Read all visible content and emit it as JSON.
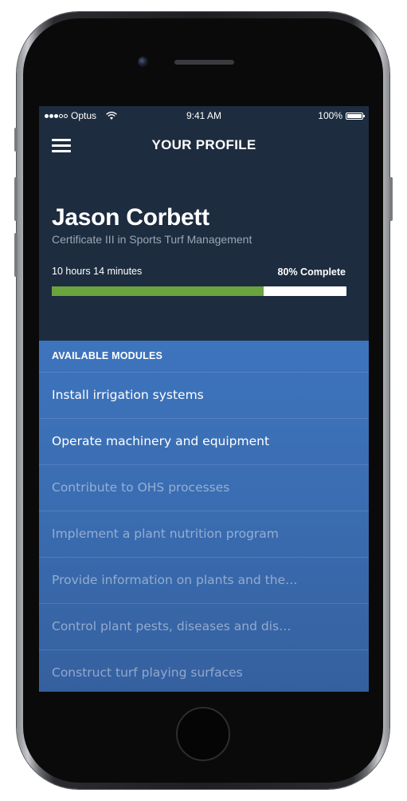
{
  "status_bar": {
    "carrier": "Optus",
    "time": "9:41 AM",
    "battery": "100%",
    "signal_dots": [
      true,
      true,
      true,
      false,
      false
    ]
  },
  "nav": {
    "title": "YOUR PROFILE",
    "menu_icon": "hamburger-icon"
  },
  "profile": {
    "name": "Jason Corbett",
    "course": "Certificate III in Sports Turf Management",
    "time_spent": "10 hours 14 minutes",
    "complete_label": "80% Complete",
    "progress_percent": 72
  },
  "modules": {
    "header": "AVAILABLE MODULES",
    "items": [
      {
        "label": "Install irrigation systems",
        "state": "active"
      },
      {
        "label": "Operate machinery and equipment",
        "state": "active"
      },
      {
        "label": "Contribute to OHS processes",
        "state": "locked"
      },
      {
        "label": "Implement a plant nutrition program",
        "state": "locked"
      },
      {
        "label": "Provide information on plants and the…",
        "state": "locked"
      },
      {
        "label": "Control plant pests, diseases and dis…",
        "state": "locked"
      },
      {
        "label": "Construct turf playing surfaces",
        "state": "locked"
      }
    ]
  },
  "colors": {
    "screen_bg": "#1d2c3f",
    "modules_bg": "#3d74bd",
    "progress_fill": "#6ba33f",
    "progress_track": "#ffffff"
  }
}
